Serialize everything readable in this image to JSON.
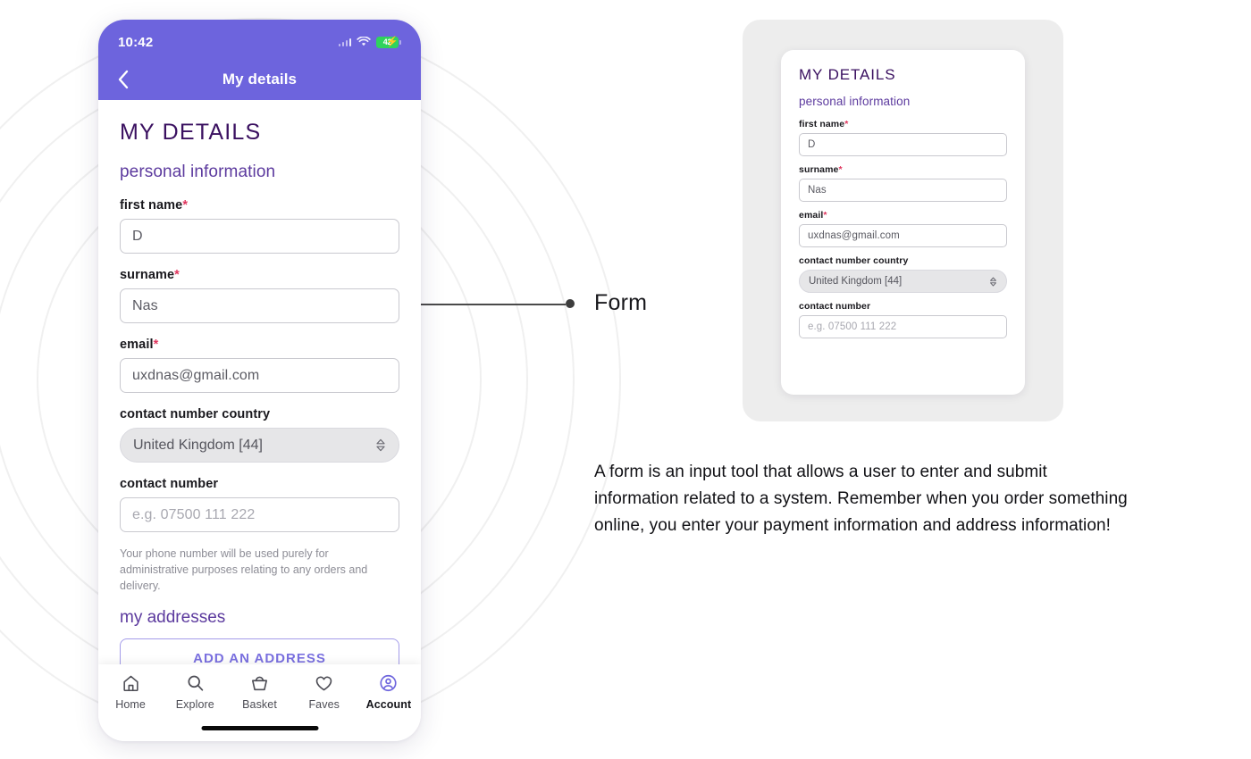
{
  "phone": {
    "status_bar": {
      "time": "10:42",
      "battery_percent": "42",
      "charging_icon": "lightning-bolt-icon",
      "wifi_icon": "wifi-icon",
      "signal_icon": "cellular-signal-icon"
    },
    "nav": {
      "back_icon": "chevron-left-icon",
      "title": "My details"
    },
    "screen_title": "MY DETAILS",
    "section_subtitle": "personal information",
    "fields": [
      {
        "label": "first name",
        "required": true,
        "value": "D",
        "is_placeholder": false,
        "type": "text"
      },
      {
        "label": "surname",
        "required": true,
        "value": "Nas",
        "is_placeholder": false,
        "type": "text"
      },
      {
        "label": "email",
        "required": true,
        "value": "uxdnas@gmail.com",
        "is_placeholder": false,
        "type": "email"
      },
      {
        "label": "contact number country",
        "required": false,
        "value": "United Kingdom [44]",
        "is_placeholder": false,
        "type": "select"
      },
      {
        "label": "contact number",
        "required": false,
        "value": "e.g. 07500 111 222",
        "is_placeholder": true,
        "type": "tel"
      }
    ],
    "helper_text": "Your phone number will be used purely for administrative purposes relating to any orders and delivery.",
    "addresses_title": "my addresses",
    "add_address_label": "ADD AN ADDRESS",
    "tabs": [
      {
        "label": "Home",
        "icon": "home-icon",
        "active": false
      },
      {
        "label": "Explore",
        "icon": "search-icon",
        "active": false
      },
      {
        "label": "Basket",
        "icon": "basket-icon",
        "active": false
      },
      {
        "label": "Faves",
        "icon": "heart-icon",
        "active": false
      },
      {
        "label": "Account",
        "icon": "account-icon",
        "active": true
      }
    ]
  },
  "callout": {
    "label": "Form"
  },
  "spec_card": {
    "screen_title": "MY DETAILS",
    "section_subtitle": "personal information",
    "fields": [
      {
        "label": "first name",
        "required": true,
        "value": "D",
        "is_placeholder": false,
        "type": "text"
      },
      {
        "label": "surname",
        "required": true,
        "value": "Nas",
        "is_placeholder": false,
        "type": "text"
      },
      {
        "label": "email",
        "required": true,
        "value": "uxdnas@gmail.com",
        "is_placeholder": false,
        "type": "email"
      },
      {
        "label": "contact number country",
        "required": false,
        "value": "United Kingdom [44]",
        "is_placeholder": false,
        "type": "select"
      },
      {
        "label": "contact number",
        "required": false,
        "value": "e.g. 07500 111 222",
        "is_placeholder": true,
        "type": "tel"
      }
    ]
  },
  "description": {
    "text": "A form is an input tool that allows a user to enter and submit information related to a system. Remember when you order something online, you enter your payment information and address information!"
  },
  "colors": {
    "brand_purple": "#6d64dd",
    "title_purple": "#3a1060",
    "subtitle_purple": "#5c3a9e",
    "required_red": "#e0365e",
    "battery_green": "#2fd35c",
    "card_gray": "#ededed"
  }
}
